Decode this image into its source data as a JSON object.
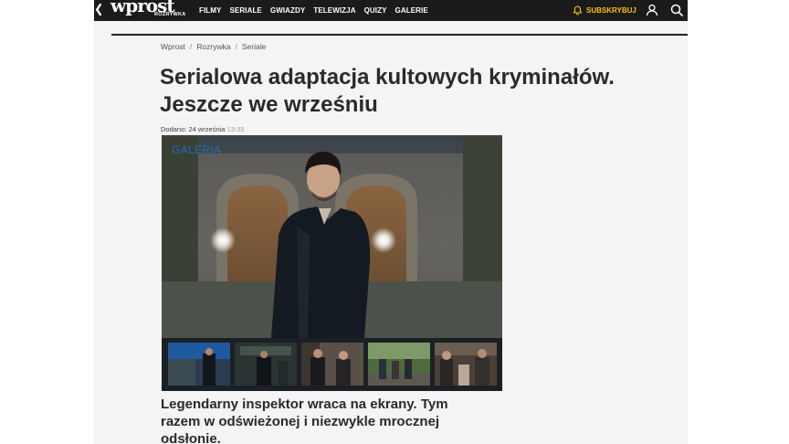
{
  "header": {
    "back_glyph": "❮",
    "logo_main": "wprost",
    "logo_sub": "ROZRYWKA",
    "nav": [
      "FILMY",
      "SERIALE",
      "GWIAZDY",
      "TELEWIZJA",
      "QUIZY",
      "GALERIE"
    ],
    "subscribe_label": "SUBSKRYBUJ",
    "icons": [
      "bell-icon",
      "user-icon",
      "search-icon"
    ],
    "accent_color": "#f7c315"
  },
  "breadcrumb": {
    "items": [
      "Wprost",
      "Rozrywka",
      "Seriale"
    ],
    "separator": "/"
  },
  "article": {
    "title": "Serialowa adaptacja kultowych kryminałów. Jeszcze we wrześniu",
    "date_prefix": "Dodano:",
    "date": "24 września",
    "time": "13:33",
    "gallery_label": "GALERIA",
    "lede": "Legendarny inspektor wraca na ekrany. Tym razem w odświeżonej i niezwykle mrocznej odsłonie."
  },
  "colors": {
    "topbar": "#1b1b1b",
    "gallery_label": "#1f6fbf",
    "title": "#2a2a2a"
  }
}
